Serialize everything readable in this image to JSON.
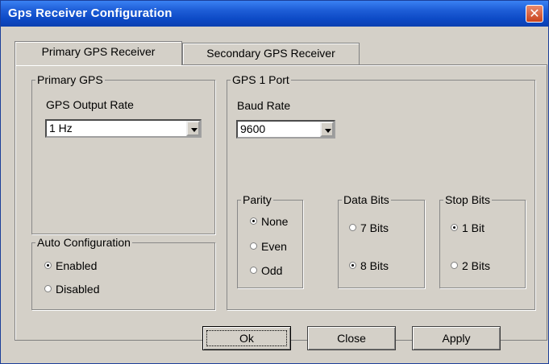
{
  "window": {
    "title": "Gps Receiver Configuration",
    "close_glyph": "✕"
  },
  "tabs": [
    {
      "label": "Primary GPS Receiver",
      "active": true
    },
    {
      "label": "Secondary GPS Receiver",
      "active": false
    }
  ],
  "primary_gps": {
    "group_label": "Primary GPS",
    "output_rate_label": "GPS Output Rate",
    "output_rate_value": "1 Hz"
  },
  "auto_configuration": {
    "group_label": "Auto Configuration",
    "options": [
      {
        "label": "Enabled",
        "selected": true
      },
      {
        "label": "Disabled",
        "selected": false
      }
    ]
  },
  "gps1_port": {
    "group_label": "GPS 1 Port",
    "baud_rate_label": "Baud Rate",
    "baud_rate_value": "9600",
    "parity": {
      "group_label": "Parity",
      "options": [
        {
          "label": "None",
          "selected": true
        },
        {
          "label": "Even",
          "selected": false
        },
        {
          "label": "Odd",
          "selected": false
        }
      ]
    },
    "data_bits": {
      "group_label": "Data Bits",
      "options": [
        {
          "label": "7 Bits",
          "selected": false
        },
        {
          "label": "8 Bits",
          "selected": true
        }
      ]
    },
    "stop_bits": {
      "group_label": "Stop Bits",
      "options": [
        {
          "label": "1 Bit",
          "selected": true
        },
        {
          "label": "2 Bits",
          "selected": false
        }
      ]
    }
  },
  "buttons": {
    "ok": "Ok",
    "close": "Close",
    "apply": "Apply"
  },
  "colors": {
    "titlebar": "#0d4ac6",
    "face": "#d4d0c8",
    "close_button": "#d9592f"
  }
}
